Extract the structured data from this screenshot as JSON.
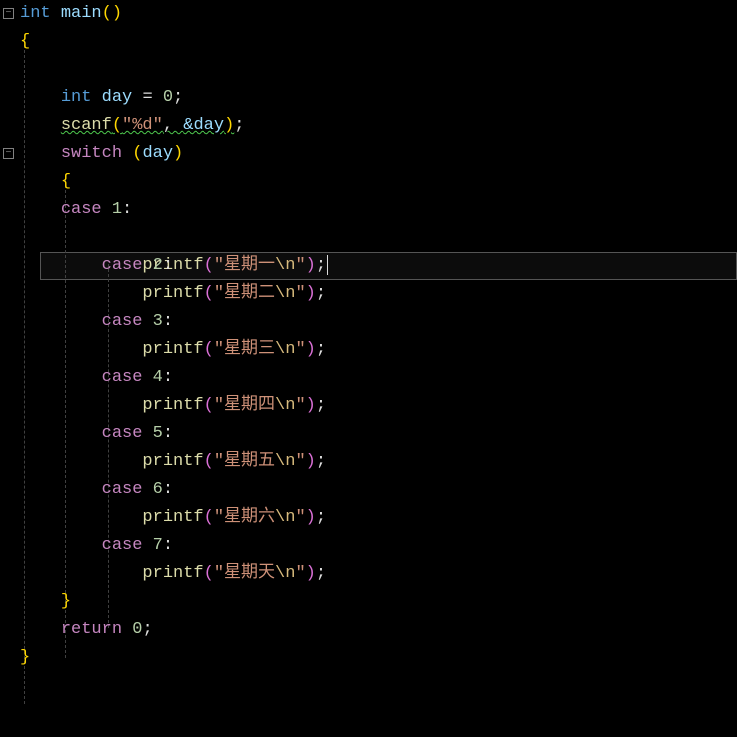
{
  "code": {
    "returnType": "int",
    "mainName": "main",
    "intKw": "int",
    "dayVar": "day",
    "assignZero": "= ",
    "zero": "0",
    "scanfName": "scanf",
    "scanfFmt": "\"%d\"",
    "ampDay": "&day",
    "switchKw": "switch",
    "switchVar": "day",
    "caseKw": "case",
    "printfName": "printf",
    "case1": "1",
    "case2": "2",
    "case3": "3",
    "case4": "4",
    "case5": "5",
    "case6": "6",
    "case7": "7",
    "str1a": "\"星期一",
    "str2a": "\"星期二",
    "str3a": "\"星期三",
    "str4a": "\"星期四",
    "str5a": "\"星期五",
    "str6a": "\"星期六",
    "str7a": "\"星期天",
    "escN": "\\n",
    "strEnd": "\"",
    "returnKw": "return",
    "retVal": "0",
    "semi": ";",
    "comma": ", ",
    "colon": ":",
    "openParen": "(",
    "closeParen": ")",
    "openBrace": "{",
    "closeBrace": "}"
  }
}
